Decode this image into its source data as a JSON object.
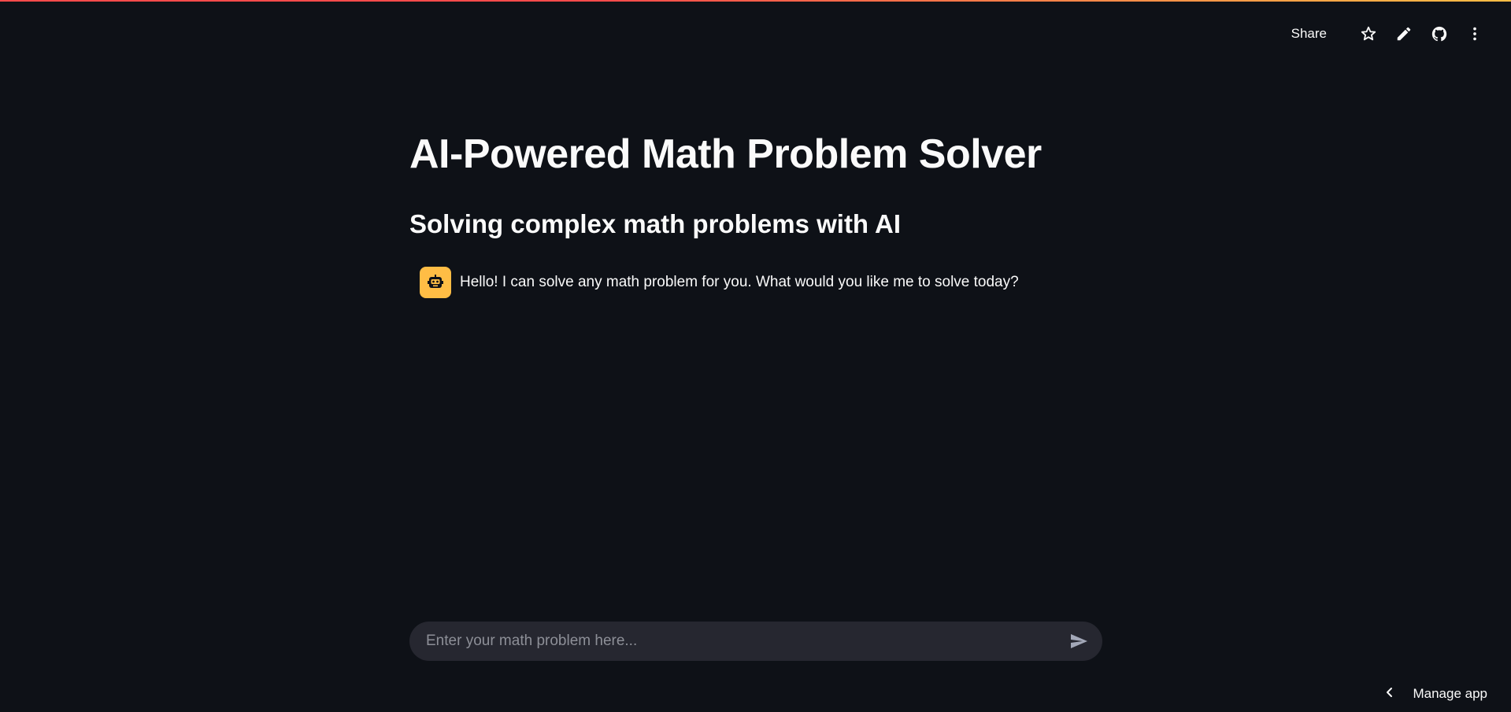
{
  "header": {
    "share_label": "Share",
    "icons": [
      "star-icon",
      "pencil-icon",
      "github-icon",
      "more-vertical-icon"
    ]
  },
  "main": {
    "title": "AI-Powered Math Problem Solver",
    "subtitle": "Solving complex math problems with AI",
    "messages": [
      {
        "role": "assistant",
        "avatar_icon": "robot-icon",
        "text": "Hello! I can solve any math problem for you. What would you like me to solve today?"
      }
    ]
  },
  "chat_input": {
    "placeholder": "Enter your math problem here...",
    "value": "",
    "send_icon": "send-icon"
  },
  "footer": {
    "manage_label": "Manage app"
  },
  "colors": {
    "background": "#0e1117",
    "input_background": "#262730",
    "avatar_background": "#ffbd45",
    "accent_red": "#ff4b4b",
    "text": "#fafafa",
    "placeholder": "#8d8f97"
  }
}
